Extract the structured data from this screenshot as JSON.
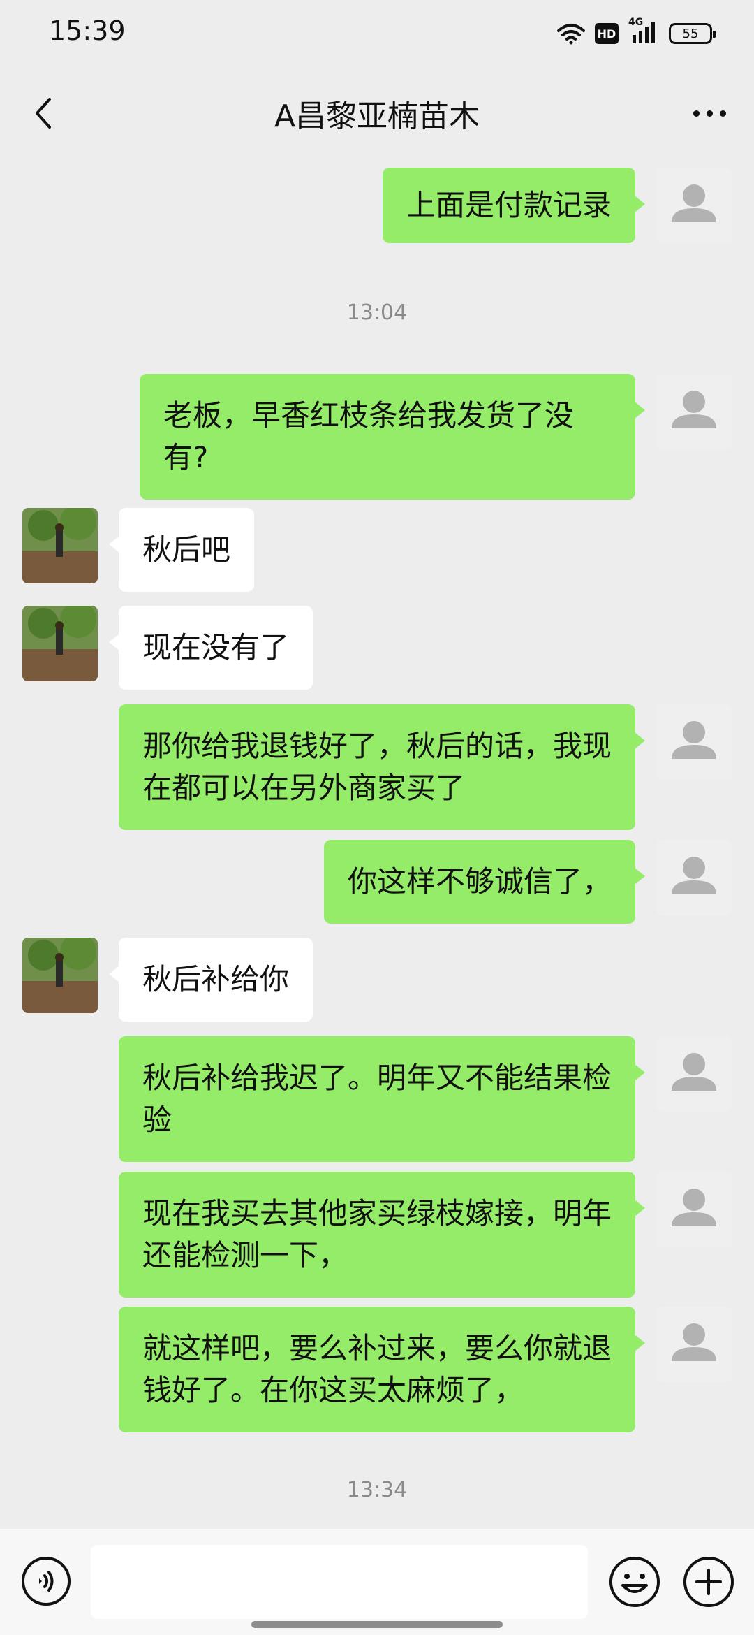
{
  "status_bar": {
    "time": "15:39",
    "network": "4G",
    "hd": "HD",
    "battery": "55"
  },
  "header": {
    "title": "A昌黎亚楠苗木"
  },
  "messages": [
    {
      "text": "上面是付款记录"
    },
    {
      "text": "13:04"
    },
    {
      "text": "老板，早香红枝条给我发货了没有?"
    },
    {
      "text": "秋后吧"
    },
    {
      "text": "现在没有了"
    },
    {
      "text": "那你给我退钱好了，秋后的话，我现在都可以在另外商家买了"
    },
    {
      "text": "你这样不够诚信了，"
    },
    {
      "text": "秋后补给你"
    },
    {
      "text": "秋后补给我迟了。明年又不能结果检验"
    },
    {
      "text": "现在我买去其他家买绿枝嫁接，明年还能检测一下，"
    },
    {
      "text": "就这样吧，要么补过来，要么你就退钱好了。在你这买太麻烦了，"
    },
    {
      "text": "13:34"
    }
  ],
  "colors": {
    "outgoing_bubble": "#95ec69",
    "incoming_bubble": "#ffffff",
    "background": "#ededed"
  },
  "icons": {
    "back": "chevron-left-icon",
    "more": "more-icon",
    "voice": "voice-icon",
    "emoji": "emoji-icon",
    "plus": "plus-icon"
  }
}
